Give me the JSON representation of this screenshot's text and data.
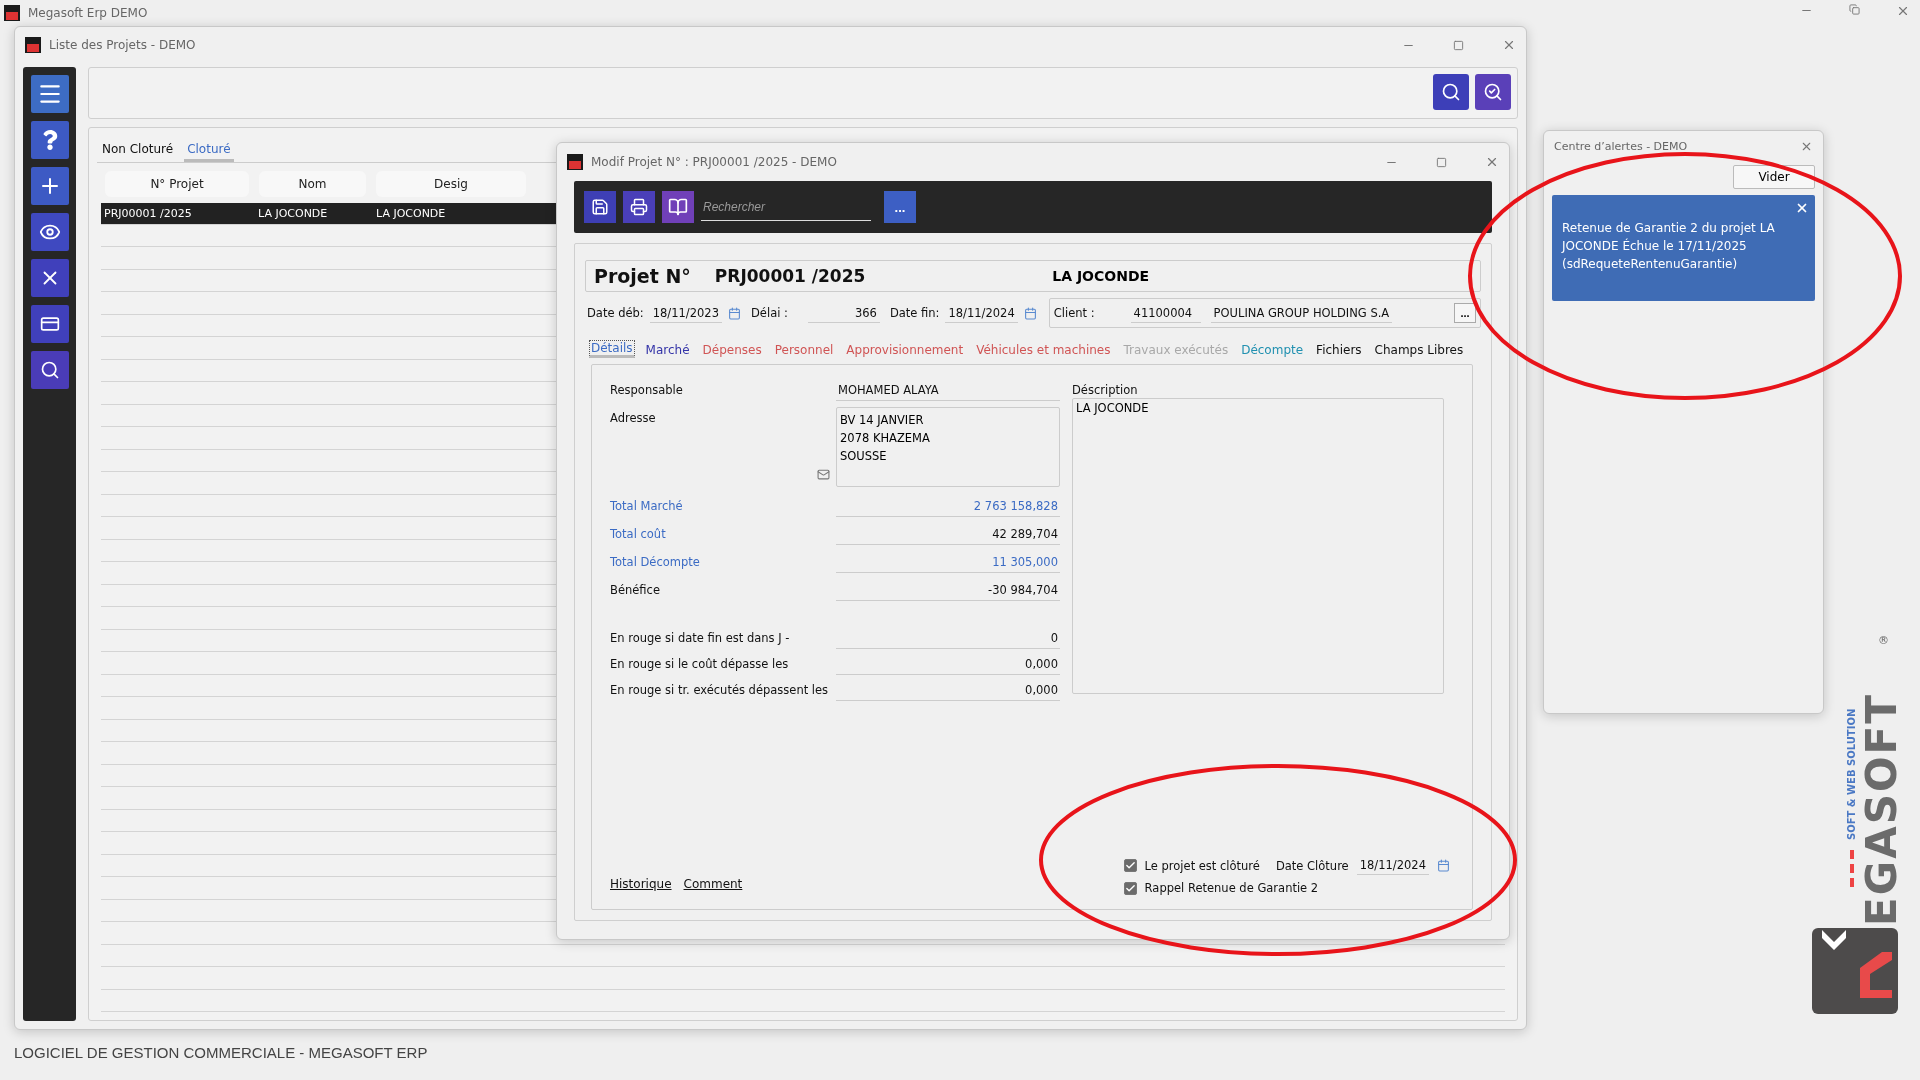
{
  "app": {
    "title": "Megasoft Erp DEMO",
    "footer": "LOGICIEL DE GESTION COMMERCIALE - MEGASOFT ERP"
  },
  "main_window": {
    "title": "Liste des Projets - DEMO",
    "tabs": [
      {
        "label": "Non Cloturé",
        "selected": false
      },
      {
        "label": "Cloturé",
        "selected": true
      }
    ],
    "columns": [
      "N° Projet",
      "Nom",
      "Desig"
    ],
    "rows": [
      {
        "cells": [
          "PRJ00001 /2025",
          "LA JOCONDE",
          "LA JOCONDE"
        ],
        "selected": true
      }
    ]
  },
  "dialog": {
    "title": "Modif  Projet N° :  PRJ00001 /2025 - DEMO",
    "search_placeholder": "Rechercher",
    "more_button": "...",
    "project": {
      "label": "Projet N°",
      "number": "PRJ00001 /2025",
      "name": "LA JOCONDE"
    },
    "dates": [
      {
        "label": "Date déb:",
        "value": "18/11/2023",
        "kind": "date"
      },
      {
        "label": "Délai :",
        "value": "366",
        "kind": "number"
      },
      {
        "label": "Date fin:",
        "value": "18/11/2024",
        "kind": "date"
      }
    ],
    "client": {
      "label": "Client :",
      "code": "41100004",
      "name": "POULINA GROUP HOLDING S.A",
      "more": "..."
    },
    "tabs": [
      {
        "label": "Détails",
        "selected": true,
        "color": "#3b6bc4"
      },
      {
        "label": "Marché",
        "selected": false,
        "color": "#3434a8"
      },
      {
        "label": "Dépenses",
        "selected": false,
        "color": "#d05454"
      },
      {
        "label": "Personnel",
        "selected": false,
        "color": "#d05454"
      },
      {
        "label": "Approvisionnement",
        "selected": false,
        "color": "#d05454"
      },
      {
        "label": "Véhicules et machines",
        "selected": false,
        "color": "#d05454"
      },
      {
        "label": "Travaux exécutés",
        "selected": false,
        "color": "#a8a8a8"
      },
      {
        "label": "Décompte",
        "selected": false,
        "color": "#2090b0"
      },
      {
        "label": "Fichiers",
        "selected": false,
        "color": "#111111"
      },
      {
        "label": "Champs Libres",
        "selected": false,
        "color": "#111111"
      }
    ],
    "responsable": {
      "label": "Responsable",
      "value": "MOHAMED ALAYA"
    },
    "adresse": {
      "label": "Adresse",
      "lines": [
        "BV 14 JANVIER",
        "2078  KHAZEMA",
        "SOUSSE"
      ]
    },
    "description": {
      "label": "Déscription",
      "value": "LA JOCONDE"
    },
    "totals": [
      {
        "label": "Total Marché",
        "value": "2 763 158,828",
        "kind": "linked"
      },
      {
        "label": "Total coût",
        "value": "42 289,704",
        "kind": "labelled"
      },
      {
        "label": "Total Décompte",
        "value": "11 305,000",
        "kind": "linked"
      },
      {
        "label": "Bénéfice",
        "value": "-30 984,704",
        "kind": "plain"
      }
    ],
    "thresholds": [
      {
        "label": "En rouge si date fin est dans J -",
        "value": "0"
      },
      {
        "label": "En rouge si le coût dépasse les",
        "value": "0,000"
      },
      {
        "label": "En rouge si tr. exécutés dépassent les",
        "value": "0,000"
      }
    ],
    "links": [
      "Historique",
      "Comment"
    ],
    "checkboxes": [
      {
        "label": "Le projet est clôturé",
        "checked": true
      },
      {
        "label": "Rappel Retenue de Garantie 2",
        "checked": true
      }
    ],
    "date_cloture": {
      "label": "Date Clôture",
      "value": "18/11/2024"
    }
  },
  "alerts": {
    "title": "Centre d’alertes - DEMO",
    "clear_button": "Vider",
    "items": [
      {
        "message": "Retenue de Garantie 2 du projet LA JOCONDE Échue le 17/11/2025 (sdRequeteRentenuGarantie)"
      }
    ]
  },
  "logo": {
    "brand": "EGASOFT",
    "tagline": "SOFT & WEB SOLUTION",
    "mark": "®"
  }
}
